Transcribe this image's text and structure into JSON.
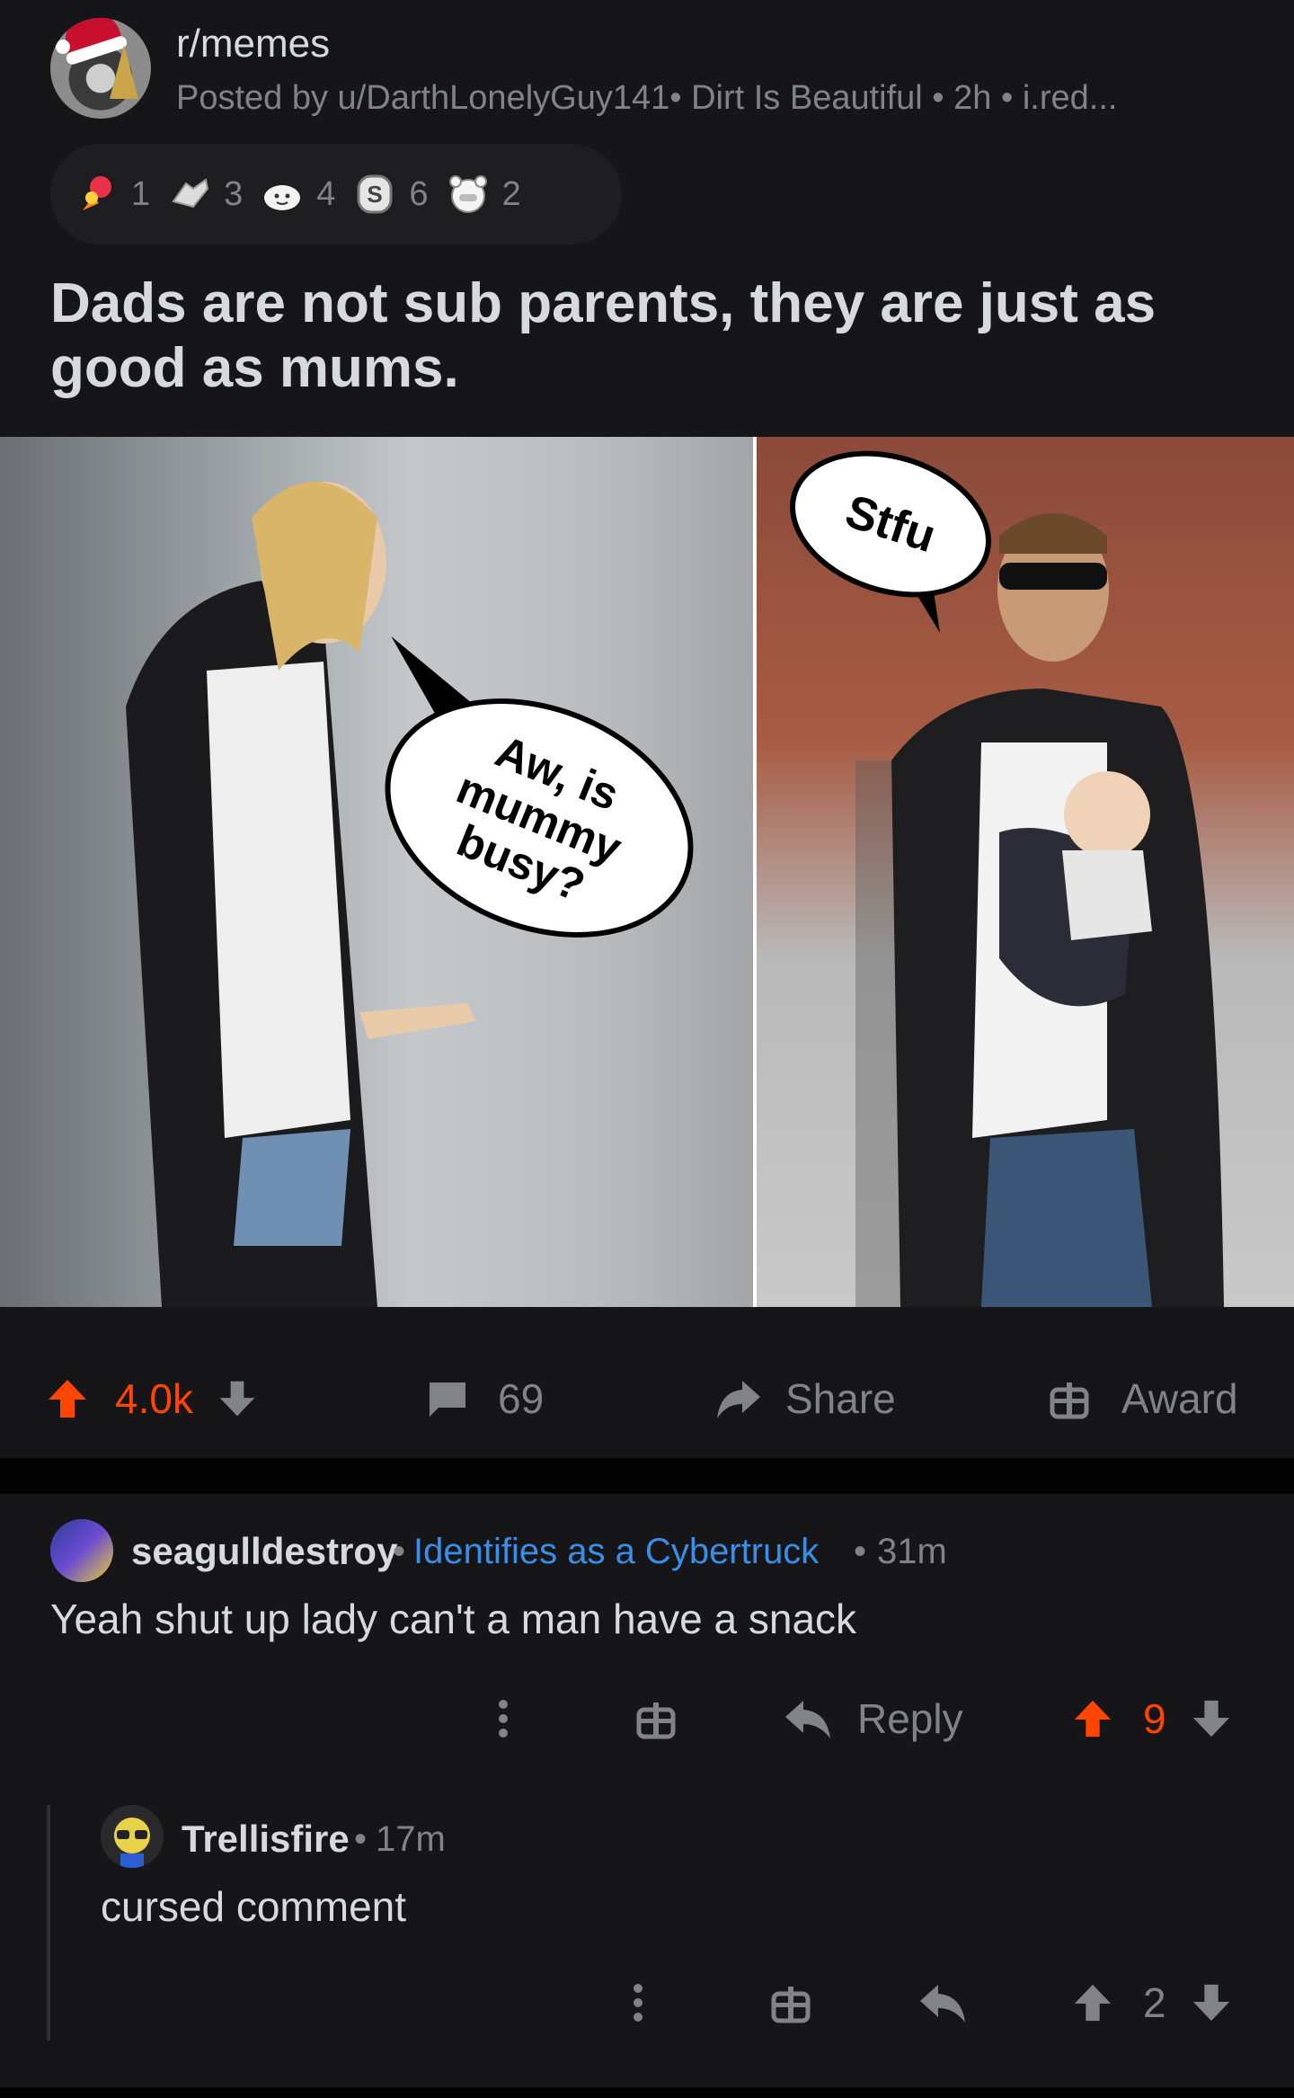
{
  "post": {
    "subreddit": "r/memes",
    "meta": "Posted by u/DarthLonelyGuy141• Dirt Is Beautiful • 2h • i.red...",
    "awards": [
      {
        "icon": "rocket-like-award-icon",
        "count": "1"
      },
      {
        "icon": "helping-hand-award-icon",
        "count": "3"
      },
      {
        "icon": "wholesome-seal-award-icon",
        "count": "4"
      },
      {
        "icon": "silver-award-icon",
        "count": "6"
      },
      {
        "icon": "facepalm-bear-award-icon",
        "count": "2"
      }
    ],
    "title": "Dads are not sub parents, they are just as good as mums.",
    "meme": {
      "bubble_left": "Aw, is mummy busy?",
      "bubble_right": "Stfu"
    },
    "actions": {
      "votes": "4.0k",
      "comments": "69",
      "share": "Share",
      "award": "Award"
    },
    "colors": {
      "upvote": "#ff4500",
      "flair": "#3a8ee6"
    }
  },
  "comments": [
    {
      "user": "seagulldestroy",
      "sep1": "•",
      "flair": "Identifies as a Cybertruck",
      "sep2": "•",
      "time": "31m",
      "body": "Yeah shut up lady can't a man have a snack",
      "reply": "Reply",
      "votes": "9"
    },
    {
      "user": "Trellisfire",
      "sep": "•",
      "time": "17m",
      "body": "cursed comment",
      "votes": "2"
    }
  ]
}
